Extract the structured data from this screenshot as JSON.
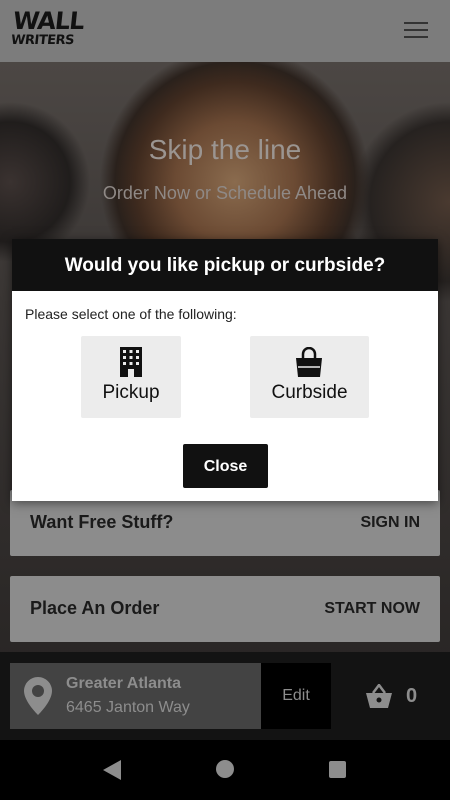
{
  "header": {
    "logo_line1": "WALL",
    "logo_line2": "WRITERS",
    "menu_icon": "hamburger-menu-icon"
  },
  "hero": {
    "title": "Skip the line",
    "subtitle": "Order Now or Schedule Ahead"
  },
  "cards": {
    "free_label": "Want Free Stuff?",
    "free_action": "SIGN IN",
    "order_label": "Place An Order",
    "order_action": "START NOW"
  },
  "footer": {
    "location_name": "Greater Atlanta",
    "location_address": "6465 Janton Way",
    "edit_label": "Edit",
    "cart_count": "0"
  },
  "modal": {
    "title": "Would you like pickup or curbside?",
    "prompt": "Please select one of the following:",
    "pickup_label": "Pickup",
    "curbside_label": "Curbside",
    "close_label": "Close"
  },
  "colors": {
    "header_bg": "#7c7c7c",
    "card_bg": "#8c8c8c",
    "modal_head_bg": "#111111",
    "option_bg": "#ececec",
    "footer_bg": "#131313"
  }
}
